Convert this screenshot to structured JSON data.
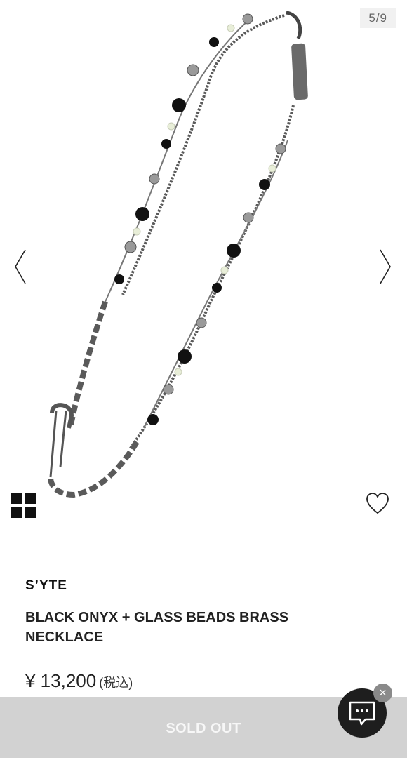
{
  "gallery": {
    "counter": "5/9",
    "current_index": 5,
    "total_images": 9,
    "prev_icon": "chevron-left-icon",
    "next_icon": "chevron-right-icon",
    "grid_icon": "grid-icon",
    "favorite_icon": "heart-outline-icon"
  },
  "product": {
    "brand": "S’YTE",
    "title": "BLACK ONYX + GLASS BEADS BRASS NECKLACE",
    "price": "¥ 13,200",
    "tax_note": "(税込)"
  },
  "purchase": {
    "button_label": "SOLD OUT",
    "button_color": "#d2d2d2"
  },
  "chat": {
    "icon": "chat-bubble-icon",
    "close_label": "×",
    "button_color": "#1e1e1e"
  }
}
